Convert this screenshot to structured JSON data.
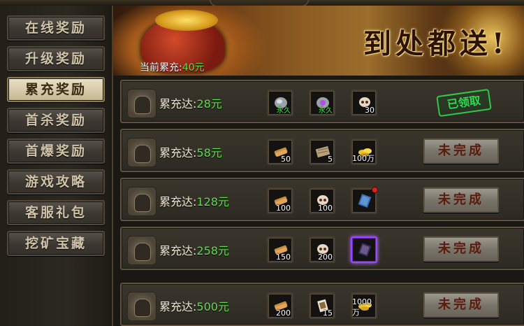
{
  "sidebar": {
    "items": [
      {
        "label": "在线奖励",
        "active": false
      },
      {
        "label": "升级奖励",
        "active": false
      },
      {
        "label": "累充奖励",
        "active": true
      },
      {
        "label": "首杀奖励",
        "active": false
      },
      {
        "label": "首爆奖励",
        "active": false
      },
      {
        "label": "游戏攻略",
        "active": false
      },
      {
        "label": "客服礼包",
        "active": false
      },
      {
        "label": "挖矿宝藏",
        "active": false
      }
    ]
  },
  "banner": {
    "slogan": "到处都送!",
    "current_label": "当前累充:",
    "current_value": "40元"
  },
  "rows": [
    {
      "label": "累充达:",
      "value": "28元",
      "items": [
        {
          "icon": "gray-stone-icon",
          "qty": "永久",
          "perm": true
        },
        {
          "icon": "purple-stone-icon",
          "qty": "永久",
          "perm": true
        },
        {
          "icon": "skull-icon",
          "qty": "30"
        }
      ],
      "status": "已领取"
    },
    {
      "label": "累充达:",
      "value": "58元",
      "items": [
        {
          "icon": "scroll-bundle-icon",
          "qty": "50"
        },
        {
          "icon": "wood-plank-icon",
          "qty": "5"
        },
        {
          "icon": "gold-ingot-icon",
          "qty": "100万"
        }
      ],
      "button": "未完成"
    },
    {
      "label": "累充达:",
      "value": "128元",
      "items": [
        {
          "icon": "scroll-bundle-icon",
          "qty": "100"
        },
        {
          "icon": "skull-icon",
          "qty": "100"
        },
        {
          "icon": "blue-book-icon",
          "qty": ""
        }
      ],
      "button": "未完成"
    },
    {
      "label": "累充达:",
      "value": "258元",
      "items": [
        {
          "icon": "scroll-bundle-icon",
          "qty": "150"
        },
        {
          "icon": "skull-icon",
          "qty": "200"
        },
        {
          "icon": "purple-book-icon",
          "qty": ""
        }
      ],
      "button": "未完成"
    },
    {
      "label": "累充达:",
      "value": "500元",
      "items": [
        {
          "icon": "scroll-bundle-icon",
          "qty": "200"
        },
        {
          "icon": "card-icon",
          "qty": "15"
        },
        {
          "icon": "gold-ingot-icon",
          "qty": "1000万"
        }
      ],
      "button": "未完成"
    }
  ],
  "colors": {
    "accent_green": "#5ee04a",
    "button_text": "#5a1a0c",
    "stamp_green": "#2fd94f"
  }
}
